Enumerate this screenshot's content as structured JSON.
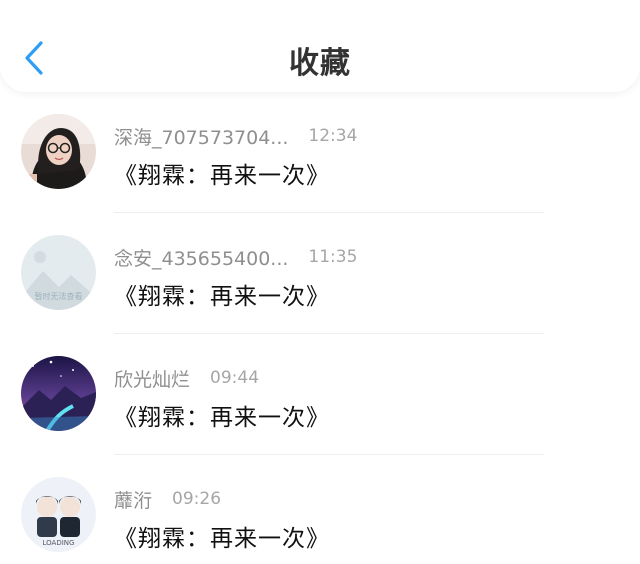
{
  "header": {
    "title": "收藏",
    "back_icon": "chevron-left-icon",
    "accent": "#2f9df4"
  },
  "items": [
    {
      "name": "深海_707573704...",
      "time": "12:34",
      "message": "《翔霖：再来一次》",
      "avatar": "avatar-girl-glasses"
    },
    {
      "name": "念安_435655400...",
      "time": "11:35",
      "message": "《翔霖：再来一次》",
      "avatar": "avatar-placeholder",
      "avatar_caption": "暂时无法查看"
    },
    {
      "name": "欣光灿烂",
      "time": "09:44",
      "message": "《翔霖：再来一次》",
      "avatar": "avatar-starry-landscape"
    },
    {
      "name": "蘼洐",
      "time": "09:26",
      "message": "《翔霖：再来一次》",
      "avatar": "avatar-cartoon-boys",
      "avatar_caption": "LOADING"
    }
  ]
}
